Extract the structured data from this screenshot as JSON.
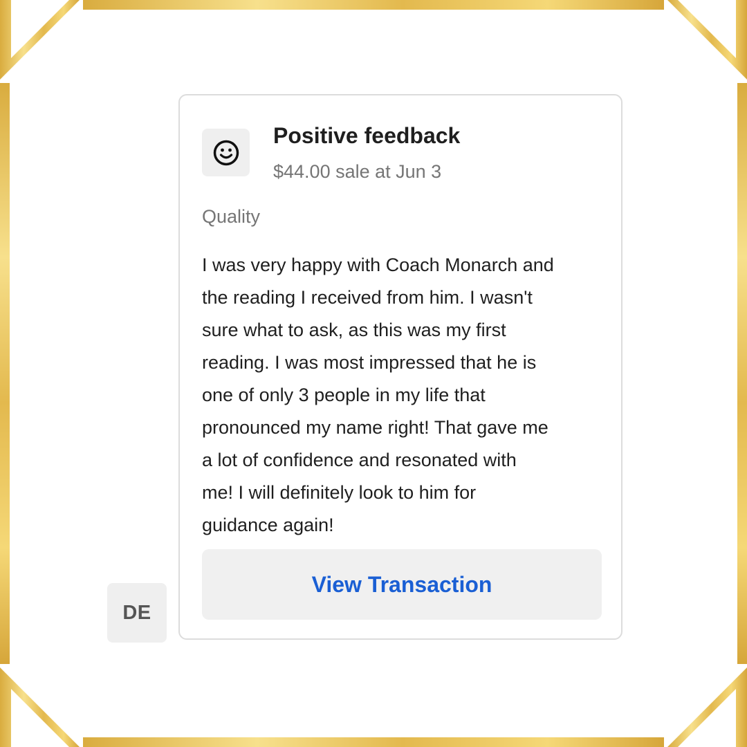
{
  "colors": {
    "gold": "#e7c15a",
    "link_blue": "#1a5fd4",
    "muted_text": "#757575",
    "body_text": "#1f1f1f"
  },
  "avatar": {
    "initials": "DE"
  },
  "feedback_card": {
    "icon": "smiley-face-icon",
    "title": "Positive feedback",
    "subtitle": "$44.00 sale at Jun 3",
    "category": "Quality",
    "review_lines": [
      "I was very happy with Coach Monarch and",
      "the reading I received from him. I wasn't",
      "sure what to ask, as this was my first",
      "reading. I was most impressed that he is",
      "one of only 3 people in my life that",
      "pronounced my name right! That gave me",
      "a lot of confidence and resonated with",
      "me! I will definitely look to him for",
      "guidance again!"
    ],
    "button_label": "View Transaction"
  }
}
